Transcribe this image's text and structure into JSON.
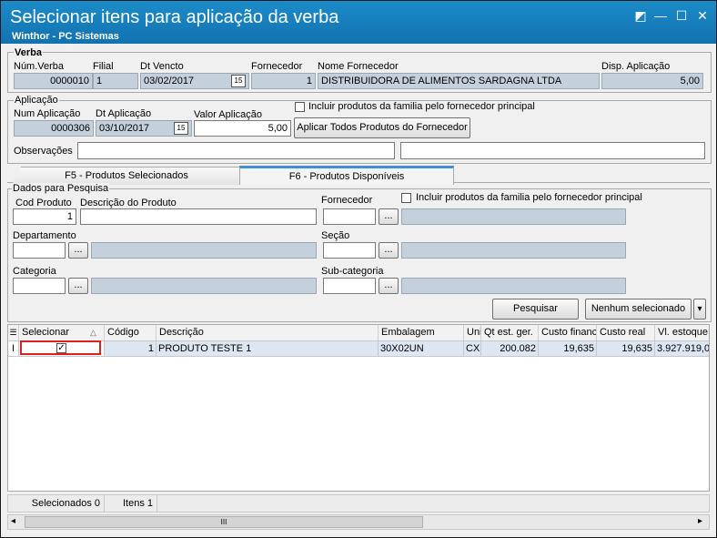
{
  "window": {
    "title": "Selecionar itens para aplicação da verba",
    "subtitle": "Winthor - PC Sistemas",
    "controls": [
      "◩",
      "—",
      "☐",
      "✕"
    ]
  },
  "verba": {
    "group_label": "Verba",
    "num_label": "Núm.Verba",
    "num_value": "0000010",
    "filial_label": "Filial",
    "filial_value": "1",
    "dtvencto_label": "Dt Vencto",
    "dtvencto_value": "03/02/2017",
    "fornecedor_label": "Fornecedor",
    "fornecedor_value": "1",
    "nome_label": "Nome Fornecedor",
    "nome_value": "DISTRIBUIDORA DE ALIMENTOS SARDAGNA LTDA",
    "disp_label": "Disp. Aplicação",
    "disp_value": "5,00"
  },
  "aplicacao": {
    "group_label": "Aplicação",
    "num_label": "Num Aplicação",
    "num_value": "0000306",
    "dt_label": "Dt Aplicação",
    "dt_value": "03/10/2017",
    "valor_label": "Valor Aplicação",
    "valor_value": "5,00",
    "incluir_label": "Incluir produtos da familia pelo fornecedor principal",
    "aplicar_button": "Aplicar Todos Produtos do Fornecedor",
    "obs_label": "Observações",
    "obs1_value": "",
    "obs2_value": ""
  },
  "tabs": [
    {
      "label": "F5 - Produtos Selecionados",
      "active": false
    },
    {
      "label": "F6 - Produtos Disponíveis",
      "active": true
    }
  ],
  "pesquisa": {
    "group_label": "Dados para Pesquisa",
    "cod_label": "Cod Produto",
    "cod_value": "1",
    "desc_label": "Descrição do Produto",
    "desc_value": "",
    "fornecedor_label": "Fornecedor",
    "fornecedor_value": "",
    "incluir_label": "Incluir produtos da familia pelo fornecedor principal",
    "departamento_label": "Departamento",
    "secao_label": "Seção",
    "categoria_label": "Categoria",
    "subcategoria_label": "Sub-categoria",
    "lookup_button": "...",
    "pesquisar_button": "Pesquisar",
    "nenhum_button": "Nenhum selecionado",
    "dropdown_glyph": "▾"
  },
  "grid": {
    "columns": [
      "Selecionar",
      "Código",
      "Descrição",
      "Embalagem",
      "Uni",
      "Qt est. ger.",
      "Custo financ",
      "Custo real",
      "Vl. estoque"
    ],
    "sort_glyph": "△",
    "row_indicator": "I",
    "rows": [
      {
        "selected": true,
        "codigo": "1",
        "descricao": "PRODUTO TESTE 1",
        "embalagem": "30X02UN",
        "uni": "CX",
        "qt": "200.082",
        "custo_fin": "19,635",
        "custo_real": "19,635",
        "vl_estoque": "3.927.919,0"
      }
    ],
    "check_glyph": "✓"
  },
  "status": {
    "selecionados": "Selecionados 0",
    "itens": "Itens 1"
  },
  "scrollbar": {
    "left": "◂",
    "right": "▸",
    "grip": "III"
  },
  "colors": {
    "title_bar": "#1a7fc0",
    "readonly_field": "#c4d0dc",
    "highlight": "#e02020",
    "active_tab": "#3c8fd4"
  }
}
